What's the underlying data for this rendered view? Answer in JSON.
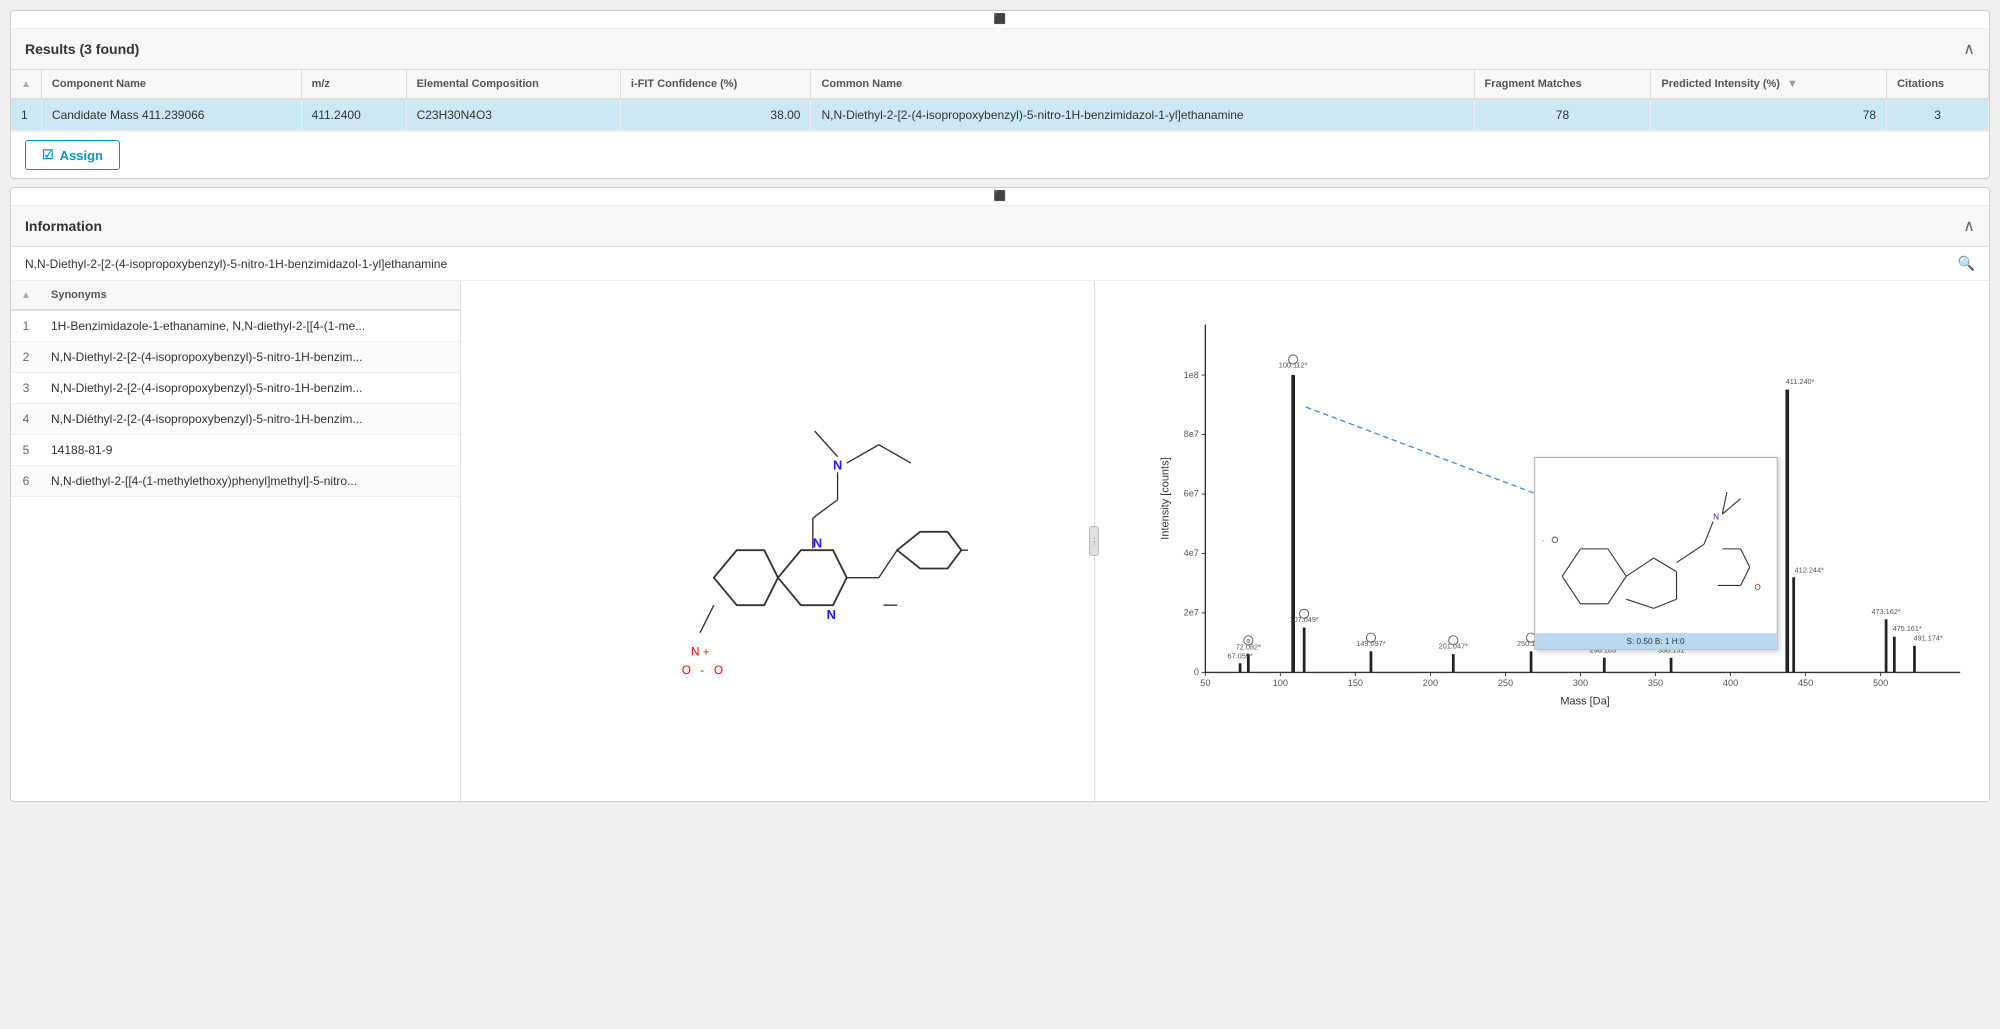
{
  "results": {
    "title": "Results (3 found)",
    "columns": [
      {
        "key": "row_num",
        "label": "#"
      },
      {
        "key": "component_name",
        "label": "Component Name"
      },
      {
        "key": "mz",
        "label": "m/z"
      },
      {
        "key": "elemental_composition",
        "label": "Elemental Composition"
      },
      {
        "key": "ifit_confidence",
        "label": "i-FIT Confidence (%)"
      },
      {
        "key": "common_name",
        "label": "Common Name"
      },
      {
        "key": "fragment_matches",
        "label": "Fragment Matches"
      },
      {
        "key": "predicted_intensity",
        "label": "Predicted Intensity (%)"
      },
      {
        "key": "citations",
        "label": "Citations"
      }
    ],
    "rows": [
      {
        "row_num": "1",
        "component_name": "Candidate Mass 411.239066",
        "mz": "411.2400",
        "elemental_composition": "C23H30N4O3",
        "ifit_confidence": "38.00",
        "common_name": "N,N-Diethyl-2-[2-(4-isopropoxybenzyl)-5-nitro-1H-benzimidazol-1-yl]ethanamine",
        "fragment_matches": "78",
        "predicted_intensity": "78",
        "citations": "3",
        "selected": true
      }
    ],
    "assign_label": "Assign"
  },
  "information": {
    "title": "Information",
    "compound_name": "N,N-Diethyl-2-[2-(4-isopropoxybenzyl)-5-nitro-1H-benzimidazol-1-yl]ethanamine",
    "synonyms_column": "Synonyms",
    "synonyms": [
      {
        "num": "1",
        "text": "1H-Benzimidazole-1-ethanamine, N,N-diethyl-2-[[4-(1-me..."
      },
      {
        "num": "2",
        "text": "N,N-Diethyl-2-[2-(4-isopropoxybenzyl)-5-nitro-1H-benzim..."
      },
      {
        "num": "3",
        "text": "N,N-Diethyl-2-[2-(4-isopropoxybenzyl)-5-nitro-1H-benzim..."
      },
      {
        "num": "4",
        "text": "N,N-Diéthyl-2-[2-(4-isopropoxybenzyl)-5-nitro-1H-benzim..."
      },
      {
        "num": "5",
        "text": "14188-81-9"
      },
      {
        "num": "6",
        "text": "N,N-diethyl-2-[[4-(1-methylethoxy)phenyl]methyl]-5-nitro..."
      }
    ],
    "popup_label": "S: 0.50 B: 1 H:0"
  },
  "spectrum": {
    "x_label": "Mass [Da]",
    "y_label": "Intensity [counts]",
    "peaks": [
      {
        "mz": "67.055*",
        "x": 67,
        "y_rel": 0.03,
        "annotated": false
      },
      {
        "mz": "72.082*",
        "x": 72,
        "y_rel": 0.06,
        "annotated": true
      },
      {
        "mz": "100.112*",
        "x": 100,
        "y_rel": 1.0,
        "annotated": true
      },
      {
        "mz": "107.049*",
        "x": 107,
        "y_rel": 0.15,
        "annotated": true
      },
      {
        "mz": "149.097*",
        "x": 149,
        "y_rel": 0.07,
        "annotated": true
      },
      {
        "mz": "201.047*",
        "x": 201,
        "y_rel": 0.06,
        "annotated": true
      },
      {
        "mz": "250.111*",
        "x": 250,
        "y_rel": 0.07,
        "annotated": true
      },
      {
        "mz": "296.103*",
        "x": 296,
        "y_rel": 0.05,
        "annotated": false
      },
      {
        "mz": "338.151",
        "x": 338,
        "y_rel": 0.05,
        "annotated": false
      },
      {
        "mz": "411.240*",
        "x": 411,
        "y_rel": 0.95,
        "annotated": false
      },
      {
        "mz": "412.244*",
        "x": 412.5,
        "y_rel": 0.32,
        "annotated": false
      },
      {
        "mz": "473.162*",
        "x": 473,
        "y_rel": 0.18,
        "annotated": false
      },
      {
        "mz": "475.161*",
        "x": 475,
        "y_rel": 0.12,
        "annotated": false
      },
      {
        "mz": "491.174*",
        "x": 491,
        "y_rel": 0.09,
        "annotated": false
      }
    ],
    "x_ticks": [
      "50",
      "100",
      "150",
      "200",
      "250",
      "300",
      "350",
      "400",
      "450",
      "500"
    ],
    "y_ticks": [
      "0",
      "2e7",
      "4e7",
      "6e7",
      "8e7",
      "1e8"
    ],
    "x_min": 45,
    "x_max": 520
  }
}
